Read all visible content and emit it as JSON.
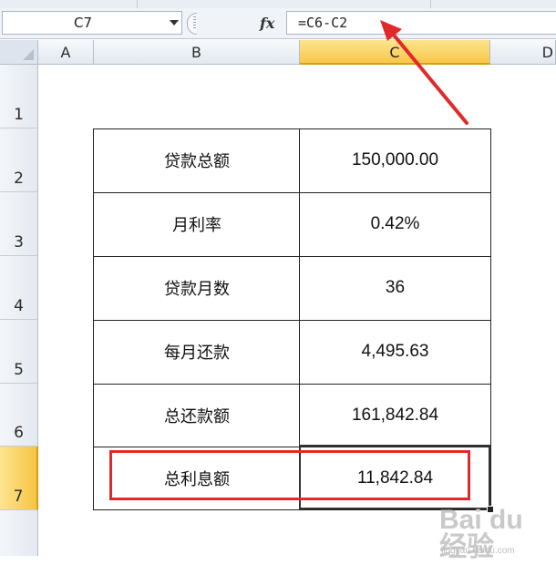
{
  "formula_bar": {
    "name_box": "C7",
    "fx_label": "fx",
    "formula": "=C6-C2"
  },
  "columns": [
    "A",
    "B",
    "C",
    "D"
  ],
  "rows": [
    "1",
    "2",
    "3",
    "4",
    "5",
    "6",
    "7"
  ],
  "active_cell": {
    "column": "C",
    "row": "7"
  },
  "table": [
    {
      "label": "贷款总额",
      "value": "150,000.00"
    },
    {
      "label": "月利率",
      "value": "0.42%"
    },
    {
      "label": "贷款月数",
      "value": "36"
    },
    {
      "label": "每月还款",
      "value": "4,495.63"
    },
    {
      "label": "总还款额",
      "value": "161,842.84"
    },
    {
      "label": "总利息额",
      "value": "11,842.84"
    }
  ],
  "annotations": {
    "arrow_color": "#e02a2a",
    "highlight_box_color": "#e02a2a"
  },
  "watermark": {
    "brand": "Bai du 经验",
    "url": "jingyan.baidu.com"
  }
}
